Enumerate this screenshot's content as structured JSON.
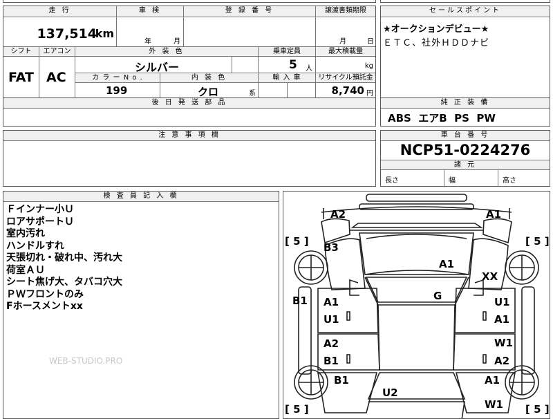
{
  "header": {
    "mileage_label": "走 行",
    "inspection_label": "車 検",
    "registration_label": "登 録 番 号",
    "transfer_label": "譲渡書類期限",
    "selling_label": "セールスポイント",
    "mileage_value": "137,514",
    "mileage_unit": "km",
    "year_unit": "年",
    "month_unit": "月",
    "month_unit2": "月",
    "day_unit": "日"
  },
  "row2": {
    "shift_label": "シフト",
    "aircon_label": "エアコン",
    "exterior_label": "外 装 色",
    "capacity_label": "乗車定員",
    "maxload_label": "最大積載量",
    "shift_value": "FAT",
    "aircon_value": "AC",
    "exterior_value": "シルバー",
    "capacity_value": "5",
    "capacity_unit": "人",
    "maxload_unit": "kg",
    "color_no_label": "カ ラ ー  N o .",
    "interior_label": "内 装 色",
    "import_label": "輸 入 車",
    "recycle_label": "リサイクル預託金",
    "color_no_value": "199",
    "interior_value": "クロ",
    "interior_unit": "系",
    "recycle_value": "8,740",
    "recycle_unit": "円"
  },
  "sales_point": {
    "line1": "★オークションデビュー★",
    "line2": "ＥＴＣ、社外ＨＤＤナビ"
  },
  "later_parts_label": "後 日 発 送 部 品",
  "genuine": {
    "label": "純 正 装 備",
    "value": "ABS  エアB  PS  PW"
  },
  "caution_label": "注 意 事 項 欄",
  "chassis": {
    "label": "車 台 番 号",
    "value": "NCP51-0224276",
    "dims_label": "諸 元",
    "length_label": "長さ",
    "width_label": "幅",
    "height_label": "高さ"
  },
  "inspector": {
    "label": "検 査 員 記 入 欄",
    "notes": [
      "Ｆインナー小Ｕ",
      "ロアサポートＵ",
      "室内汚れ",
      "ハンドルすれ",
      "天張切れ・破れ中、汚れ大",
      "荷室ＡＵ",
      "シート焦げ大、タバコ穴大",
      "ＰＷフロントのみ",
      "Fホースメントxx"
    ],
    "watermark": "WEB-STUDIO.PRO"
  },
  "diagram": {
    "tire_fl": "[ 5 ]",
    "tire_fr": "[ 5 ]",
    "tire_rl": "[ 5 ]",
    "tire_rr": "[ 5 ]",
    "labels": {
      "front_left_corner": "A2",
      "front_right_corner": "A1",
      "left_fender": "B3",
      "hood": "A1",
      "right_fender": "XX",
      "left_sill": "B1",
      "roof": "G",
      "front_left_door_top": "A1",
      "front_left_door_bottom": "U1",
      "front_right_door_top": "U1",
      "front_right_door_bottom": "A1",
      "rear_left_door_top": "A2",
      "rear_left_door_bottom": "B1",
      "rear_right_door_top": "W1",
      "rear_right_door_bottom": "A2",
      "left_quarter": "B1",
      "trunk": "U2",
      "right_quarter_top": "A1",
      "right_quarter_bottom": "W1"
    }
  }
}
